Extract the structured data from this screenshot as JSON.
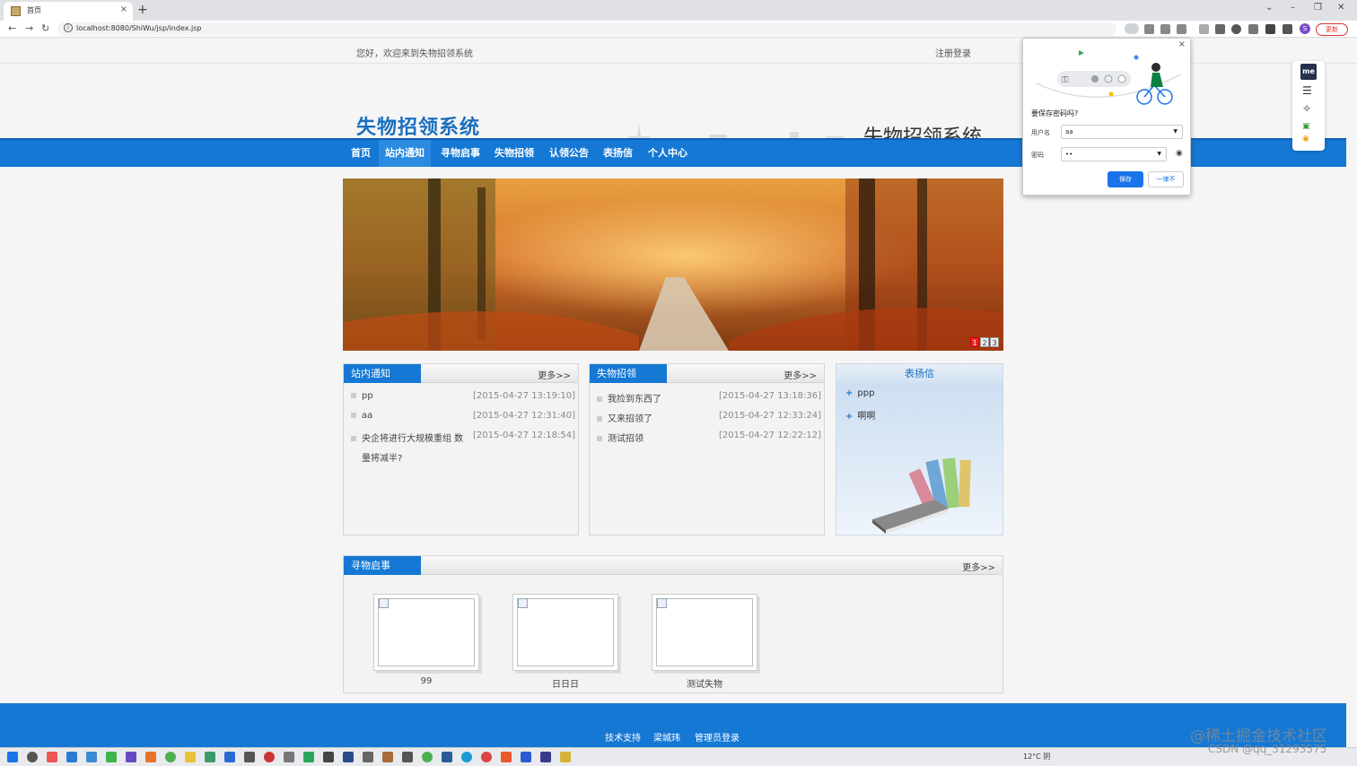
{
  "browser": {
    "tab_title": "首页",
    "tab_close": "×",
    "new_tab": "+",
    "url": "localhost:8080/ShiWu/jsp/index.jsp",
    "update_label": "更新",
    "profile_initial": "S"
  },
  "topbar": {
    "welcome": "您好，欢迎来到失物招领系统",
    "register_login": "注册登录"
  },
  "header": {
    "logo": "失物招领系统",
    "right_title": "失物招领系统"
  },
  "nav": {
    "items": [
      {
        "label": "首页"
      },
      {
        "label": "站内通知"
      },
      {
        "label": "寻物启事"
      },
      {
        "label": "失物招领"
      },
      {
        "label": "认领公告"
      },
      {
        "label": "表扬信"
      },
      {
        "label": "个人中心"
      }
    ],
    "active_index": 1
  },
  "banner": {
    "dots": [
      "1",
      "2",
      "3"
    ],
    "active_dot": 0
  },
  "notices": {
    "title": "站内通知",
    "more": "更多>>",
    "items": [
      {
        "title": "pp",
        "date": "[2015-04-27 13:19:10]"
      },
      {
        "title": "aa",
        "date": "[2015-04-27 12:31:40]"
      },
      {
        "title": "央企将进行大规模重组 数",
        "title2": "量将减半?",
        "date": "[2015-04-27 12:18:54]"
      }
    ]
  },
  "lost_found": {
    "title": "失物招领",
    "more": "更多>>",
    "items": [
      {
        "title": "我捡到东西了",
        "date": "[2015-04-27 13:18:36]"
      },
      {
        "title": "又来招领了",
        "date": "[2015-04-27 12:33:24]"
      },
      {
        "title": "测试招领",
        "date": "[2015-04-27 12:22:12]"
      }
    ]
  },
  "praise": {
    "title": "表扬信",
    "items": [
      {
        "title": "ppp"
      },
      {
        "title": "啊啊"
      }
    ]
  },
  "seeking": {
    "title": "寻物启事",
    "more": "更多>>",
    "items": [
      {
        "caption": "99"
      },
      {
        "caption": "日日日"
      },
      {
        "caption": "测试失物"
      }
    ]
  },
  "footer": {
    "links": [
      "技术支持",
      "梁城玮",
      "管理员登录"
    ]
  },
  "password_popup": {
    "question": "要保存密码吗?",
    "username_label": "用户名",
    "username_value": "aa",
    "password_label": "密码",
    "password_value": "••",
    "save_label": "保存",
    "never_label": "一律不",
    "close": "×"
  },
  "side_panel": {
    "me_label": "me"
  },
  "taskbar": {
    "weather": "12°C 阴"
  },
  "watermark": {
    "line1": "@稀土掘金技术社区",
    "line2": "CSDN @qq_31293575"
  },
  "colors": {
    "brand_blue": "#1478d4",
    "logo_blue": "#1a6fbf"
  }
}
